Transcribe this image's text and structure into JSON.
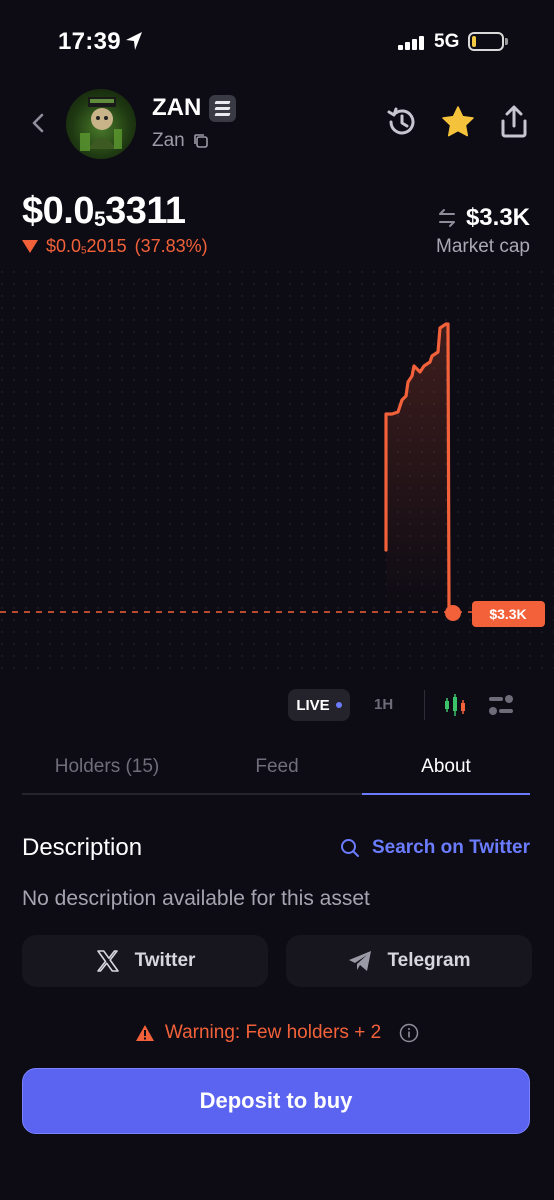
{
  "status_bar": {
    "time": "17:39",
    "network": "5G",
    "battery_level": 0.1
  },
  "header": {
    "token_name": "ZAN",
    "token_subname": "Zan",
    "chain_icon": "solana-icon",
    "actions": [
      "history-icon",
      "star-icon",
      "share-icon"
    ]
  },
  "price": {
    "prefix": "$0.0",
    "subscript": "5",
    "digits": "3311",
    "change_prefix": "$0.0",
    "change_subscript": "5",
    "change_digits": "2015",
    "change_percent": "(37.83%)",
    "direction": "down"
  },
  "market_cap": {
    "value": "$3.3K",
    "label": "Market cap"
  },
  "chart": {
    "current_label": "$3.3K",
    "line_color": "#f2613a",
    "grid": "dotted"
  },
  "chart_controls": {
    "live_label": "LIVE",
    "interval_label": "1H"
  },
  "tabs": {
    "holders": "Holders (15)",
    "feed": "Feed",
    "about": "About",
    "active": "about"
  },
  "about": {
    "title": "Description",
    "search_label": "Search on Twitter",
    "description": "No description available for this asset",
    "twitter_label": "Twitter",
    "telegram_label": "Telegram"
  },
  "warning": {
    "text": "Warning: Few holders + 2"
  },
  "cta": {
    "deposit_label": "Deposit to buy"
  },
  "colors": {
    "background": "#0d0b14",
    "accent": "#6b7cff",
    "negative": "#f2613a",
    "button": "#5a64f0"
  }
}
